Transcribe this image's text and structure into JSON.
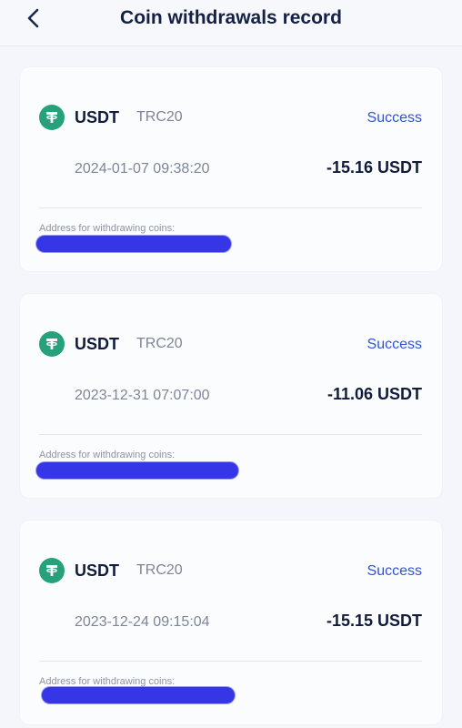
{
  "header": {
    "title": "Coin withdrawals record",
    "back_icon": "chevron-left-icon"
  },
  "colors": {
    "accent_blue": "#2f53d6",
    "tether_green": "#26a17b",
    "redaction_blue": "#3536e6"
  },
  "records": [
    {
      "coin": "USDT",
      "network": "TRC20",
      "status": "Success",
      "time": "2024-01-07 09:38:20",
      "amount": "-15.16 USDT",
      "address_label": "Address for withdrawing coins:",
      "icon": "tether-icon"
    },
    {
      "coin": "USDT",
      "network": "TRC20",
      "status": "Success",
      "time": "2023-12-31 07:07:00",
      "amount": "-11.06 USDT",
      "address_label": "Address for withdrawing coins:",
      "icon": "tether-icon"
    },
    {
      "coin": "USDT",
      "network": "TRC20",
      "status": "Success",
      "time": "2023-12-24 09:15:04",
      "amount": "-15.15 USDT",
      "address_label": "Address for withdrawing coins:",
      "icon": "tether-icon"
    }
  ]
}
